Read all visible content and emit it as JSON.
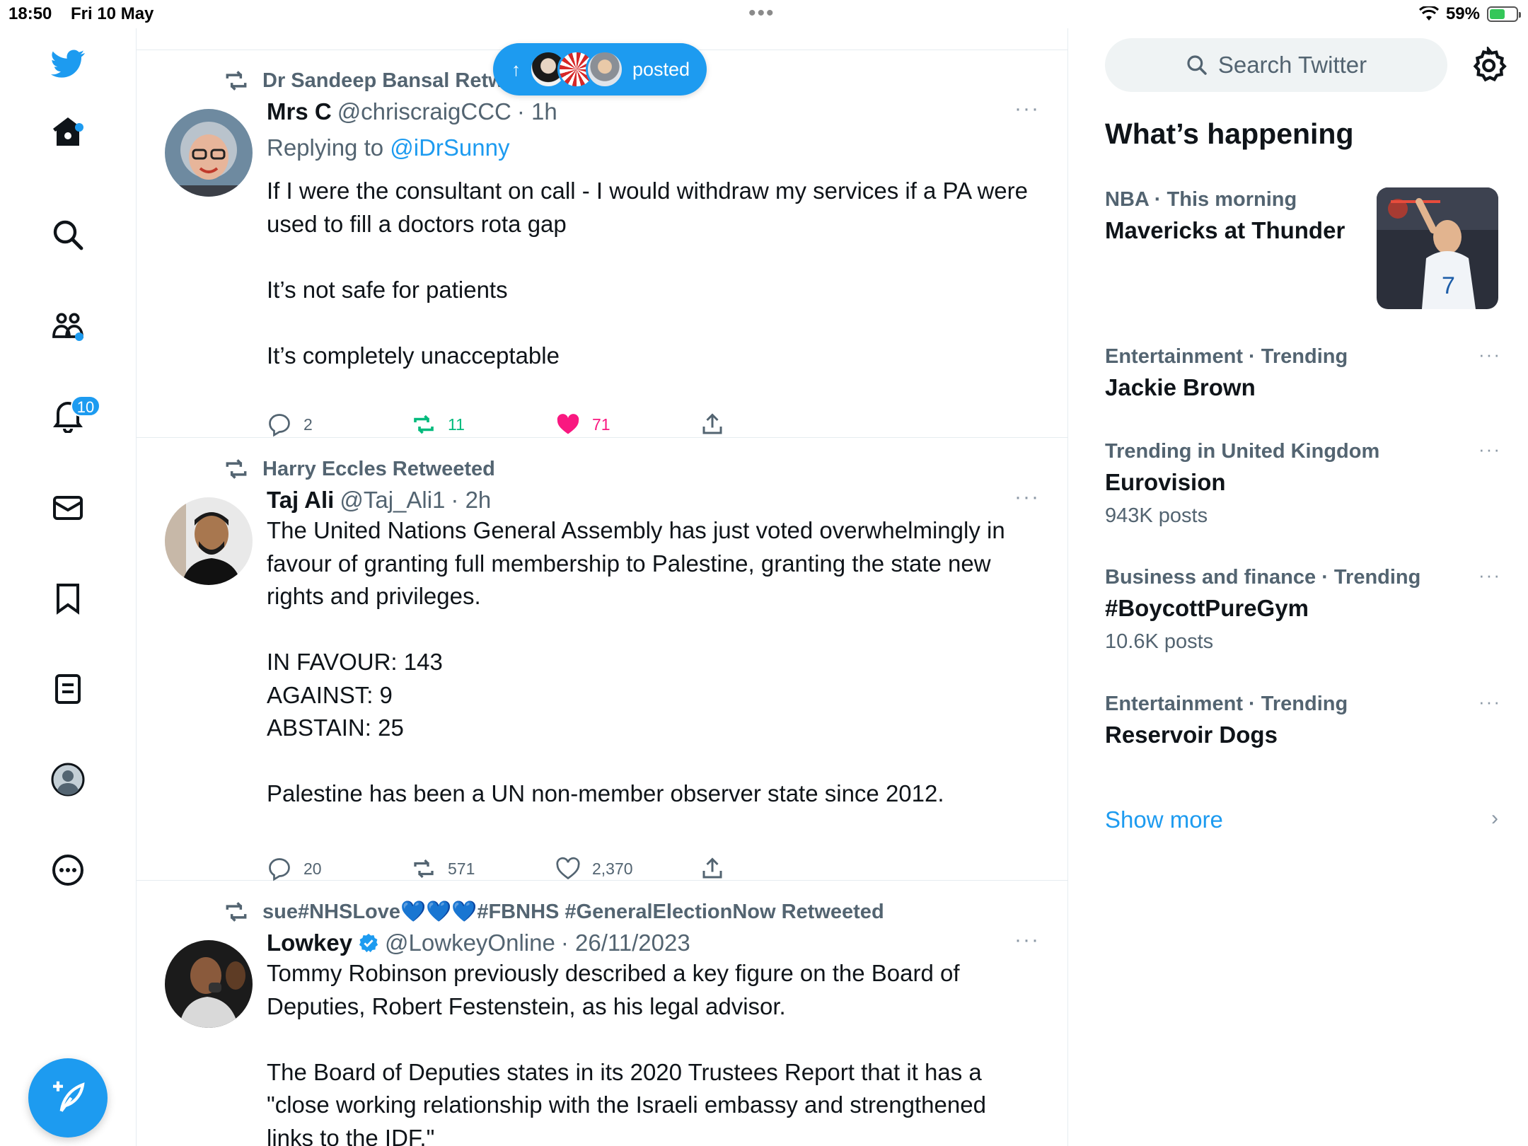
{
  "status_bar": {
    "time": "18:50",
    "date": "Fri 10 May",
    "battery": "59%",
    "battery_level": 0.59
  },
  "nav": {
    "icons": [
      "twitter-logo-icon",
      "home-icon",
      "search-icon",
      "communities-icon",
      "notifications-icon",
      "messages-icon",
      "bookmarks-icon",
      "lists-icon",
      "profile-icon",
      "more-icon"
    ],
    "notifications_badge": "10",
    "compose_icon": "compose-icon"
  },
  "new_posts_pill": {
    "arrow": "↑",
    "label": "posted"
  },
  "tweets": [
    {
      "retweeted_by": "Dr Sandeep Bansal Retweeted",
      "name": "Mrs C",
      "handle": "@chriscraigCCC",
      "time": "· 1h",
      "replying_label": "Replying to ",
      "replying_to": "@iDrSunny",
      "body": "If I were the consultant on call - I would withdraw my services if a PA were used to fill a doctors rota gap\n\nIt’s not safe for patients\n\nIt’s completely unacceptable",
      "replies": "2",
      "retweets": "11",
      "likes": "71",
      "more": "···"
    },
    {
      "retweeted_by": "Harry Eccles Retweeted",
      "name": "Taj Ali",
      "handle": "@Taj_Ali1",
      "time": "· 2h",
      "body": "The United Nations General Assembly has just voted overwhelmingly in favour of granting full membership to Palestine, granting the state new rights and privileges.\n\nIN FAVOUR: 143\nAGAINST: 9\nABSTAIN: 25\n\nPalestine has been a UN non-member observer state since 2012.",
      "replies": "20",
      "retweets": "571",
      "likes": "2,370",
      "more": "···"
    },
    {
      "retweeted_by": "sue#NHSLove💙💙💙#FBNHS #GeneralElectionNow Retweeted",
      "name": "Lowkey",
      "handle": "@LowkeyOnline",
      "time": "· 26/11/2023",
      "body": "Tommy Robinson previously described a key figure on the Board of Deputies, Robert Festenstein, as his legal advisor.\n\nThe Board of Deputies states in its 2020 Trustees Report that it has a \"close working relationship with the Israeli embassy and strengthened links to the IDF.\"",
      "more": "···"
    }
  ],
  "sidebar": {
    "search_placeholder": "Search Twitter",
    "whats_happening": "What’s happening",
    "trends": [
      {
        "meta": "NBA · This morning",
        "name": "Mavericks at Thunder"
      },
      {
        "meta": "Entertainment · Trending",
        "name": "Jackie Brown"
      },
      {
        "meta": "Trending in United Kingdom",
        "name": "Eurovision",
        "count": "943K posts"
      },
      {
        "meta": "Business and finance · Trending",
        "name": "#BoycottPureGym",
        "count": "10.6K posts"
      },
      {
        "meta": "Entertainment · Trending",
        "name": "Reservoir Dogs"
      }
    ],
    "show_more": "Show more",
    "more": "···"
  },
  "colors": {
    "accent": "#1d9bf0",
    "retweet": "#00ba7c",
    "like": "#f91880",
    "secondary_text": "#536471"
  }
}
